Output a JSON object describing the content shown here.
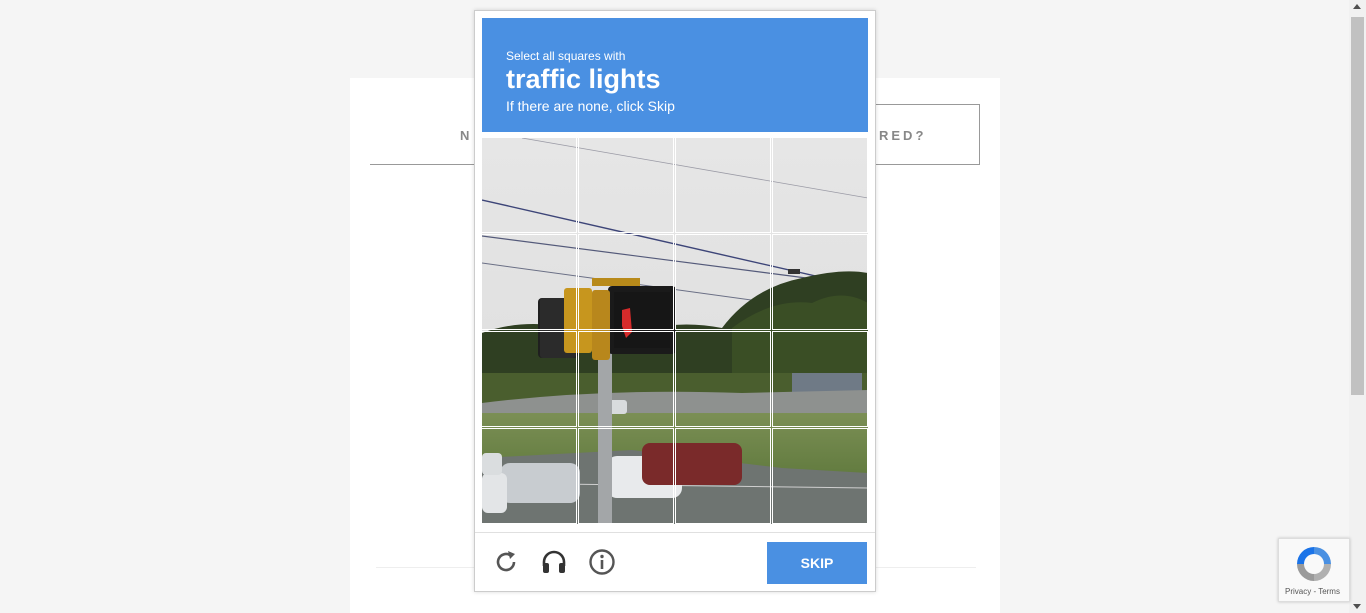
{
  "background_page": {
    "tab_left_partial": "N",
    "tab_right_partial": "RED?"
  },
  "captcha": {
    "instruction_small": "Select all squares with",
    "target_object": "traffic lights",
    "instruction_sub": "If there are none, click Skip",
    "grid": {
      "rows": 4,
      "cols": 4
    },
    "footer": {
      "reload_icon": "reload-icon",
      "audio_icon": "headphones-icon",
      "info_icon": "info-icon",
      "skip_label": "SKIP"
    },
    "colors": {
      "accent": "#4a90e2"
    }
  },
  "recaptcha_badge": {
    "links": "Privacy - Terms"
  }
}
